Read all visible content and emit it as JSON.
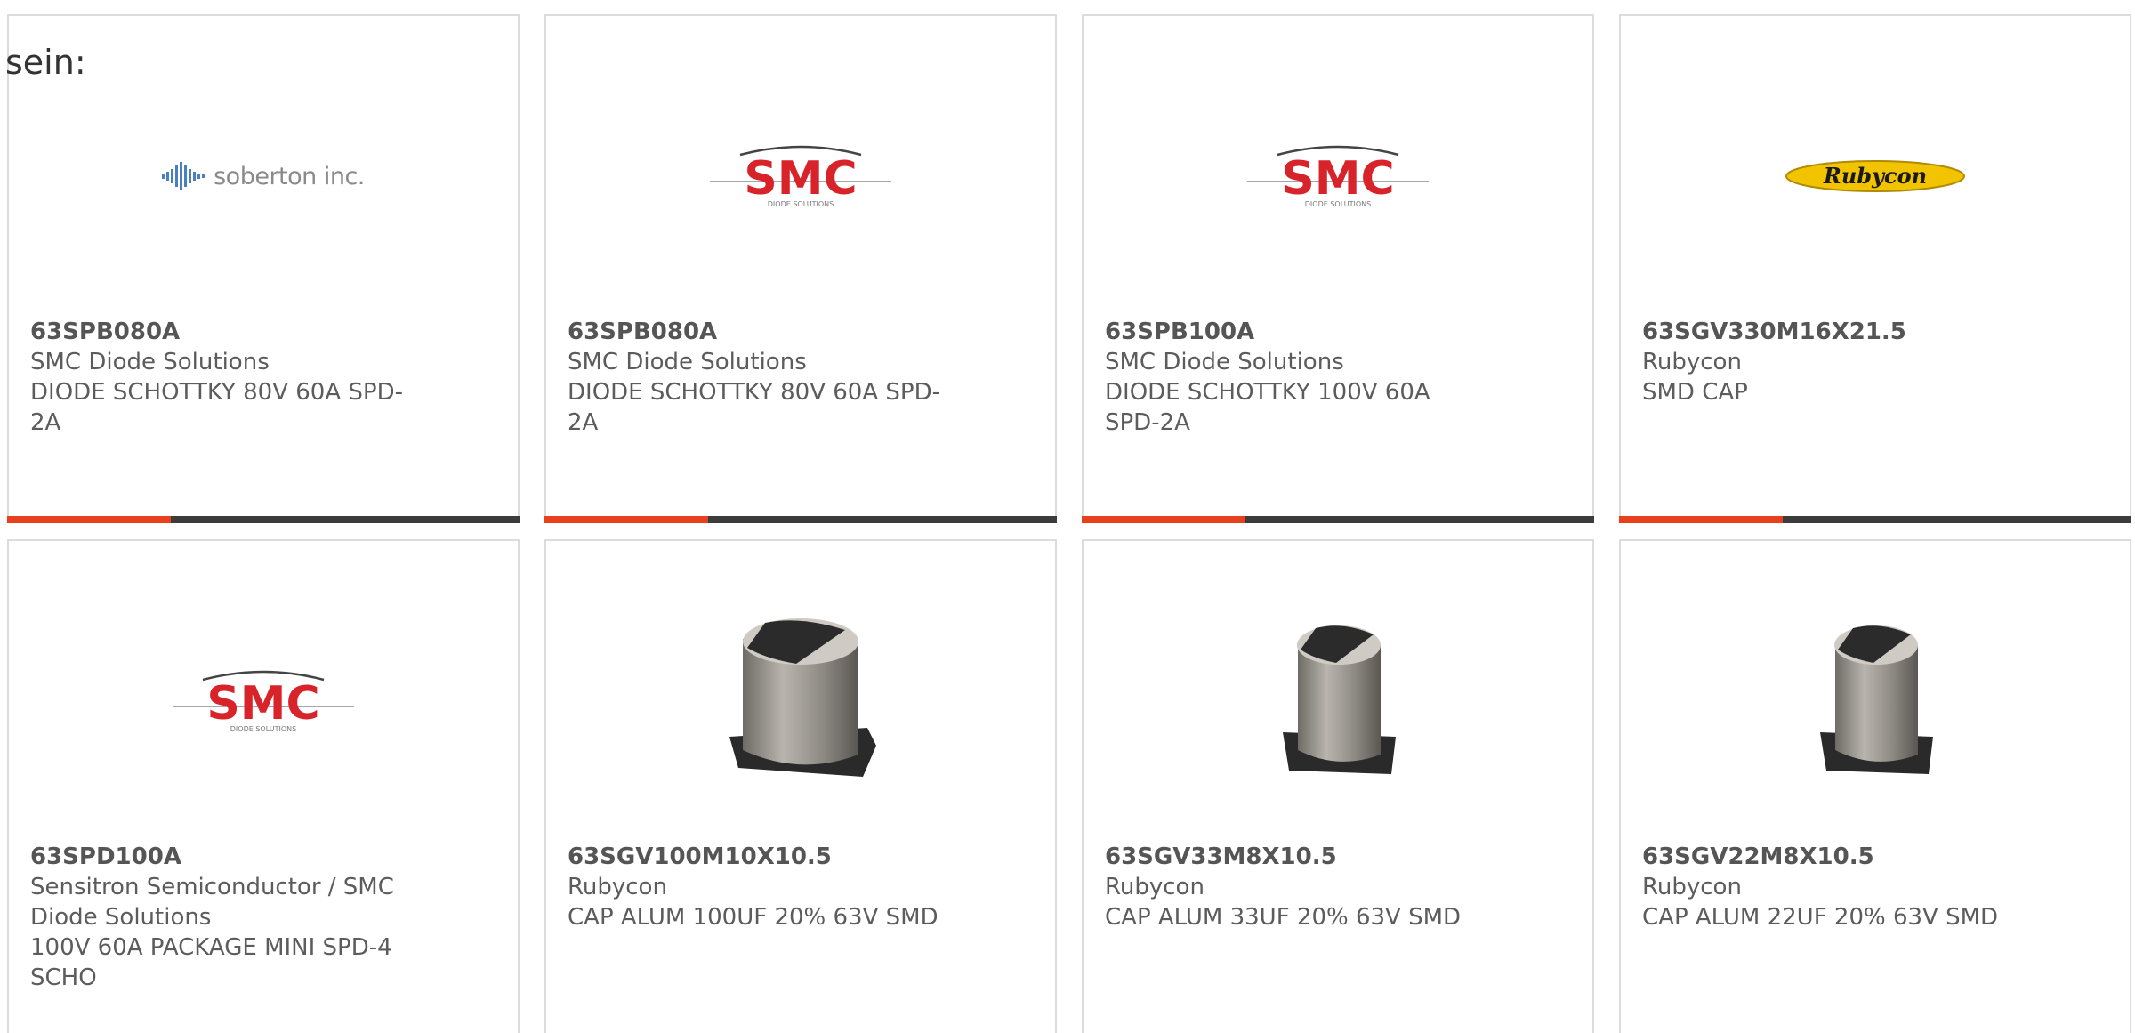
{
  "intro": "sein:",
  "products": [
    {
      "part": "63SPB080A",
      "manufacturer": "SMC Diode Solutions",
      "description": "DIODE SCHOTTKY 80V 60A SPD-",
      "description2": "2A",
      "description3": "",
      "logo": "soberton-logo"
    },
    {
      "part": "63SPB080A",
      "manufacturer": "SMC Diode Solutions",
      "description": "DIODE SCHOTTKY 80V 60A SPD-",
      "description2": "2A",
      "description3": "",
      "logo": "smc-logo"
    },
    {
      "part": "63SPB100A",
      "manufacturer": "SMC Diode Solutions",
      "description": "DIODE SCHOTTKY 100V 60A",
      "description2": "SPD-2A",
      "description3": "",
      "logo": "smc-logo"
    },
    {
      "part": "63SGV330M16X21.5",
      "manufacturer": "Rubycon",
      "description": "SMD CAP",
      "description2": "",
      "description3": "",
      "logo": "rubycon-logo"
    },
    {
      "part": "63SPD100A",
      "manufacturer": "Sensitron Semiconductor / SMC",
      "description": "Diode Solutions",
      "description2": "100V 60A PACKAGE MINI SPD-4",
      "description3": "SCHO",
      "logo": "smc-logo"
    },
    {
      "part": "63SGV100M10X10.5",
      "manufacturer": "Rubycon",
      "description": "CAP ALUM 100UF 20% 63V SMD",
      "description2": "",
      "description3": "",
      "logo": "capacitor-image"
    },
    {
      "part": "63SGV33M8X10.5",
      "manufacturer": "Rubycon",
      "description": "CAP ALUM 33UF 20% 63V SMD",
      "description2": "",
      "description3": "",
      "logo": "capacitor-image"
    },
    {
      "part": "63SGV22M8X10.5",
      "manufacturer": "Rubycon",
      "description": "CAP ALUM 22UF 20% 63V SMD",
      "description2": "",
      "description3": "",
      "logo": "capacitor-image"
    }
  ],
  "logos": {
    "soberton_text": "soberton inc.",
    "smc_text": "SMC",
    "smc_sub": "DIODE SOLUTIONS",
    "rubycon_text": "Rubycon"
  },
  "colors": {
    "accent": "#e8401c",
    "bar": "#3c3c3c",
    "smc_red": "#d8232a",
    "rubycon_yellow": "#f2c400"
  }
}
